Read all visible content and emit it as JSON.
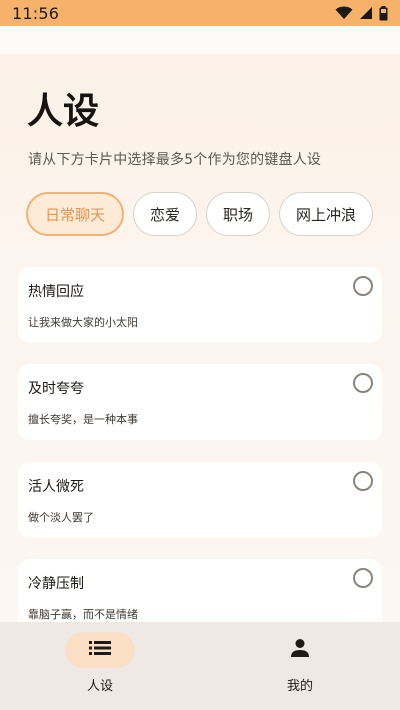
{
  "status_bar": {
    "time": "11:56",
    "icons": [
      "wifi-icon",
      "signal-icon",
      "battery-icon"
    ],
    "background": "#f6b26b"
  },
  "page": {
    "title": "人设",
    "subtitle": "请从下方卡片中选择最多5个作为您的键盘人设"
  },
  "chips": [
    {
      "label": "日常聊天",
      "active": true
    },
    {
      "label": "恋爱",
      "active": false
    },
    {
      "label": "职场",
      "active": false
    },
    {
      "label": "网上冲浪",
      "active": false
    }
  ],
  "cards": [
    {
      "title": "热情回应",
      "desc": "让我来做大家的小太阳",
      "selected": false
    },
    {
      "title": "及时夸夸",
      "desc": "擅长夸奖，是一种本事",
      "selected": false
    },
    {
      "title": "活人微死",
      "desc": "做个淡人罢了",
      "selected": false
    },
    {
      "title": "冷静压制",
      "desc": "靠脑子赢，而不是情绪",
      "selected": false
    }
  ],
  "bottom_nav": [
    {
      "label": "人设",
      "icon": "list-icon",
      "active": true
    },
    {
      "label": "我的",
      "icon": "person-icon",
      "active": false
    }
  ],
  "colors": {
    "accent": "#f2b272",
    "accent_text": "#e8954b",
    "active_pill": "#fadfc4"
  }
}
